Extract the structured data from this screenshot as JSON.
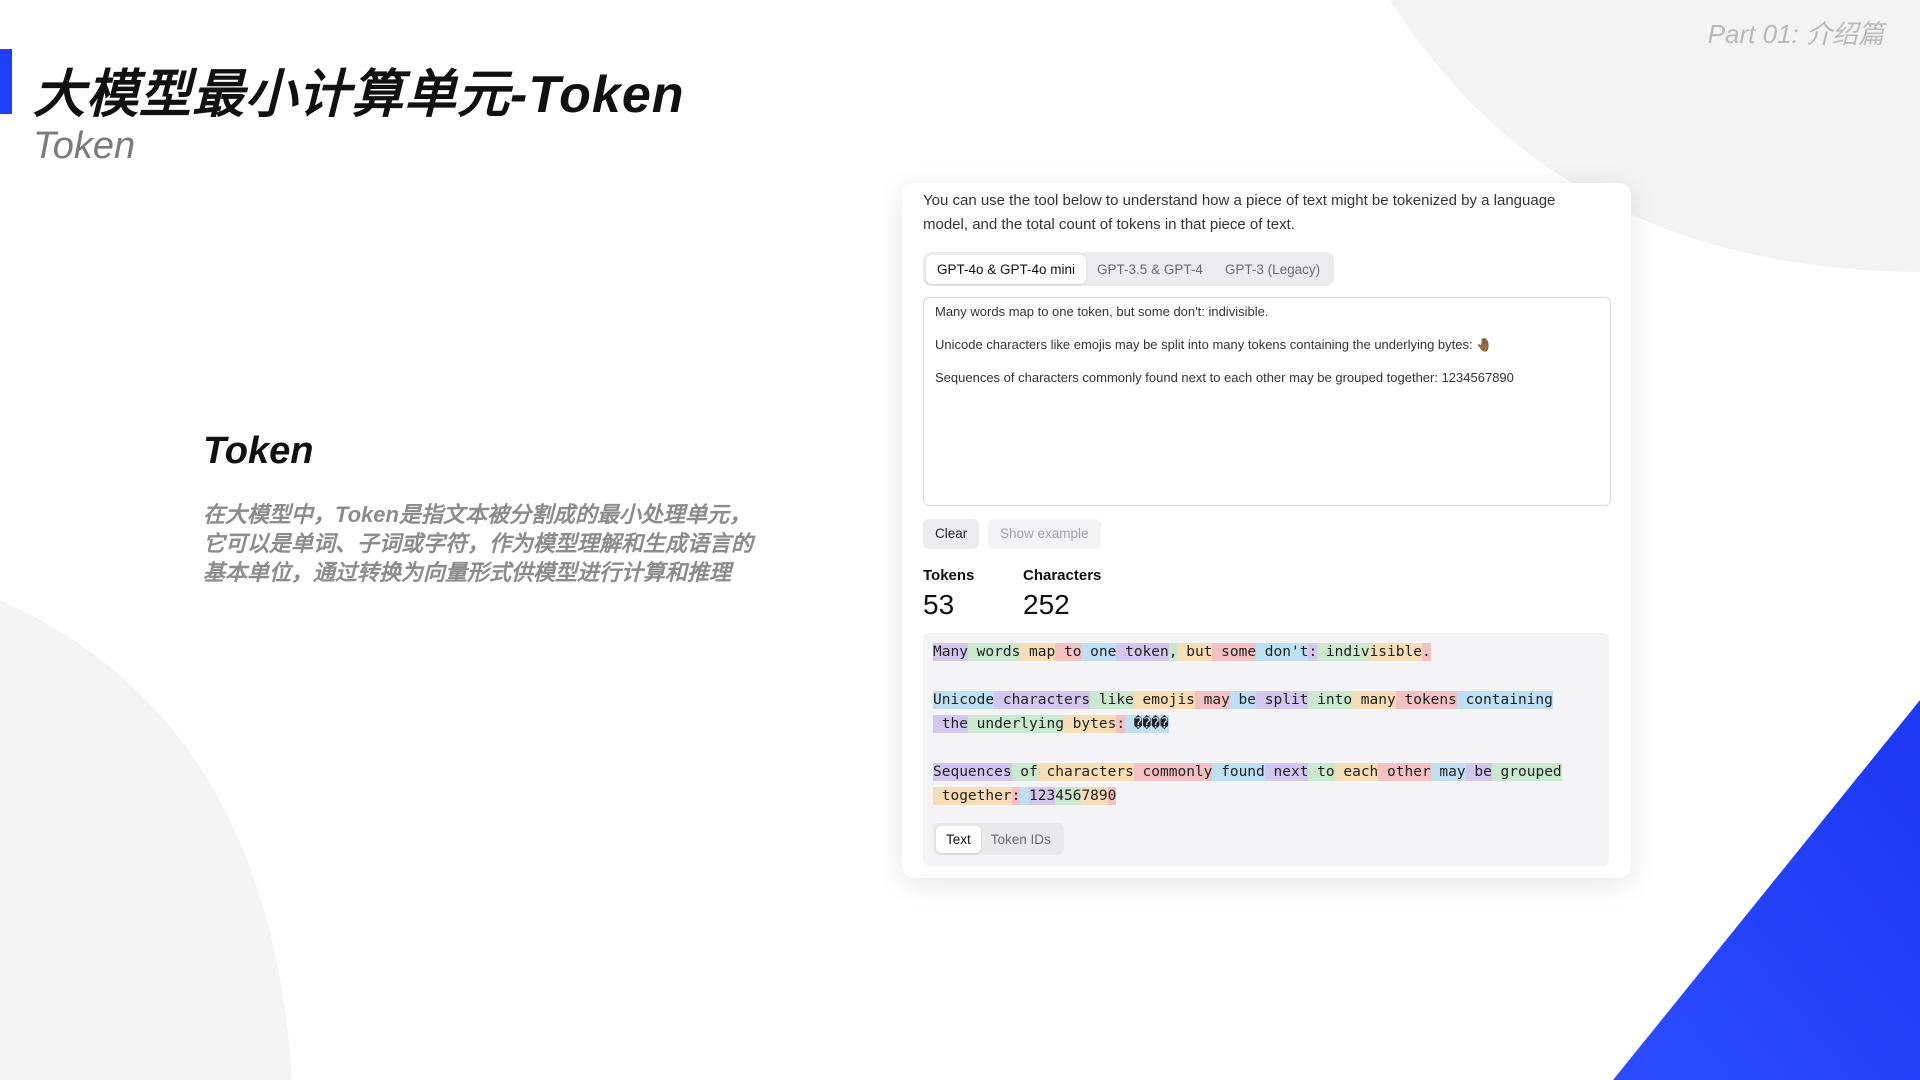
{
  "slide": {
    "title": "大模型最小计算单元-Token",
    "subtitle": "Token",
    "part_label": "Part 01:   介绍篇",
    "accent_color": "#1f3fff"
  },
  "concept": {
    "heading": "Token",
    "lines": [
      "在大模型中，Token是指文本被分割成的最小处理单元，",
      "它可以是单词、子词或字符，作为模型理解和生成语言的",
      "基本单位，通过转换为向量形式供模型进行计算和推理"
    ]
  },
  "tokenizer": {
    "intro_lines": [
      "You can use the tool below to understand how a piece of text might be tokenized by a language",
      "model, and the total count of tokens in that piece of text."
    ],
    "model_tabs": [
      {
        "label": "GPT-4o & GPT-4o mini",
        "active": true
      },
      {
        "label": "GPT-3.5 & GPT-4",
        "active": false
      },
      {
        "label": "GPT-3 (Legacy)",
        "active": false
      }
    ],
    "input_lines": [
      "Many words map to one token, but some don't: indivisible.",
      "Unicode characters like emojis may be split into many tokens containing the underlying bytes: 🤚🏾",
      "Sequences of characters commonly found next to each other may be grouped together: 1234567890"
    ],
    "clear_label": "Clear",
    "show_example_label": "Show example",
    "tokens_label": "Tokens",
    "tokens_value": "53",
    "characters_label": "Characters",
    "characters_value": "252",
    "token_lines": [
      [
        "Many",
        " words",
        " map",
        " to",
        " one",
        " token",
        ",",
        " but",
        " some",
        " don't",
        ":",
        " indiv",
        "isible",
        "."
      ],
      [
        "Unicode",
        " characters",
        " like",
        " emojis",
        " may",
        " be",
        " split",
        " into",
        " many",
        " tokens",
        " containing"
      ],
      [
        " the",
        " underlying",
        " bytes",
        ":",
        " ����"
      ],
      [
        "Sequences",
        " of",
        " characters",
        " commonly",
        " found",
        " next",
        " to",
        " each",
        " other",
        " may",
        " be",
        " grouped"
      ],
      [
        " together",
        ":",
        " ",
        "123",
        "456",
        "789",
        "0"
      ]
    ],
    "view_tabs": [
      {
        "label": "Text",
        "active": true
      },
      {
        "label": "Token IDs",
        "active": false
      }
    ]
  }
}
